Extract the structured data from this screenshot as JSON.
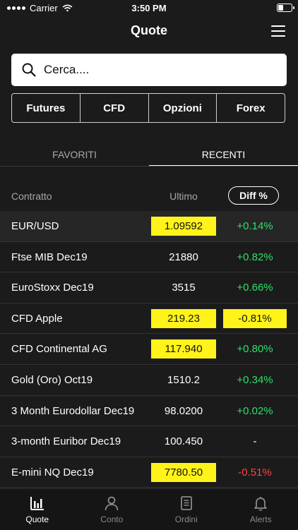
{
  "status_bar": {
    "carrier": "Carrier",
    "time": "3:50 PM"
  },
  "nav": {
    "title": "Quote"
  },
  "search": {
    "placeholder": "Cerca...."
  },
  "segments": [
    "Futures",
    "CFD",
    "Opzioni",
    "Forex"
  ],
  "tabs": {
    "favorites": "FAVORITI",
    "recent": "RECENTI"
  },
  "table_header": {
    "contract": "Contratto",
    "last": "Ultimo",
    "diff": "Diff %"
  },
  "rows": [
    {
      "name": "EUR/USD",
      "last": "1.09592",
      "diff": "+0.14%"
    },
    {
      "name": "Ftse MIB Dec19",
      "last": "21880",
      "diff": "+0.82%"
    },
    {
      "name": "EuroStoxx Dec19",
      "last": "3515",
      "diff": "+0.66%"
    },
    {
      "name": "CFD Apple",
      "last": "219.23",
      "diff": "-0.81%"
    },
    {
      "name": "CFD Continental AG",
      "last": "117.940",
      "diff": "+0.80%"
    },
    {
      "name": "Gold (Oro) Oct19",
      "last": "1510.2",
      "diff": "+0.34%"
    },
    {
      "name": "3 Month Eurodollar Dec19",
      "last": "98.0200",
      "diff": "+0.02%"
    },
    {
      "name": "3-month Euribor Dec19",
      "last": "100.450",
      "diff": "-"
    },
    {
      "name": "E-mini NQ Dec19",
      "last": "7780.50",
      "diff": "-0.51%"
    }
  ],
  "tab_bar": {
    "quote": "Quote",
    "account": "Conto",
    "orders": "Ordini",
    "alerts": "Alerts"
  },
  "colors": {
    "positive": "#2ee06a",
    "negative": "#ff4343",
    "highlight": "#fff31a"
  },
  "icons": [
    "wifi-icon",
    "battery-icon",
    "menu-icon",
    "search-icon",
    "bar-chart-icon",
    "person-icon",
    "document-icon",
    "bell-icon"
  ]
}
